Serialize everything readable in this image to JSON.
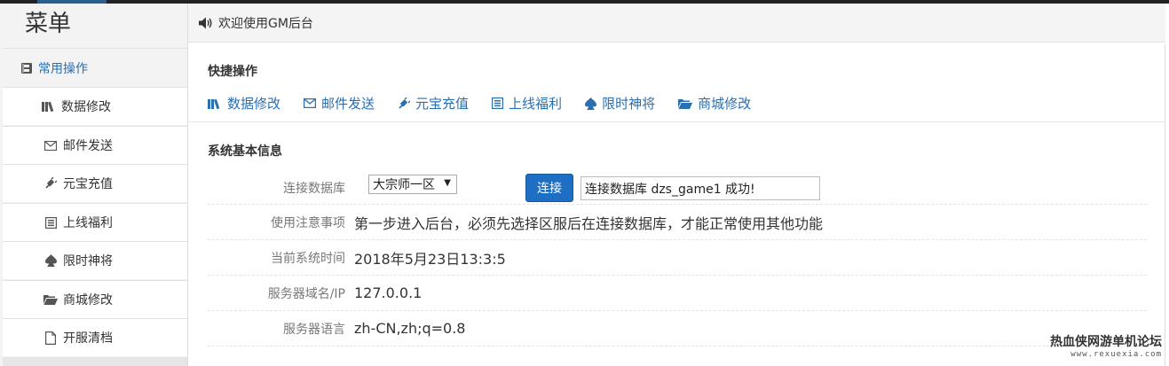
{
  "sidebar": {
    "title": "菜单",
    "header": {
      "label": "常用操作",
      "icon": "book-icon"
    },
    "items": [
      {
        "label": "数据修改",
        "icon": "books-icon"
      },
      {
        "label": "邮件发送",
        "icon": "envelope-icon"
      },
      {
        "label": "元宝充值",
        "icon": "plug-icon"
      },
      {
        "label": "上线福利",
        "icon": "list-box-icon"
      },
      {
        "label": "限时神将",
        "icon": "spade-icon"
      },
      {
        "label": "商城修改",
        "icon": "folder-open-icon"
      },
      {
        "label": "开服清档",
        "icon": "file-icon"
      }
    ]
  },
  "header": {
    "text": "欢迎使用GM后台",
    "icon": "volume-icon"
  },
  "quick": {
    "title": "快捷操作",
    "links": [
      {
        "label": "数据修改",
        "icon": "books-icon"
      },
      {
        "label": "邮件发送",
        "icon": "envelope-icon"
      },
      {
        "label": "元宝充值",
        "icon": "plug-icon"
      },
      {
        "label": "上线福利",
        "icon": "list-box-icon"
      },
      {
        "label": "限时神将",
        "icon": "spade-icon"
      },
      {
        "label": "商城修改",
        "icon": "folder-open-icon"
      }
    ]
  },
  "info": {
    "title": "系统基本信息",
    "db": {
      "label": "连接数据库",
      "selected": "大宗师一区",
      "button": "连接",
      "result": "连接数据库 dzs_game1 成功!"
    },
    "notice": {
      "label": "使用注意事项",
      "value": "第一步进入后台，必须先选择区服后在连接数据库，才能正常使用其他功能"
    },
    "time": {
      "label": "当前系统时间",
      "value": "2018年5月23日13:3:5"
    },
    "host": {
      "label": "服务器域名/IP",
      "value": "127.0.0.1"
    },
    "lang": {
      "label": "服务器语言",
      "value": "zh-CN,zh;q=0.8"
    }
  },
  "watermark": {
    "line1": "热血侠网游单机论坛",
    "line2": "www.rexuexia.com"
  },
  "colors": {
    "accent": "#2a6fb0",
    "button": "#1e6fc4",
    "topbar": "#222222"
  }
}
